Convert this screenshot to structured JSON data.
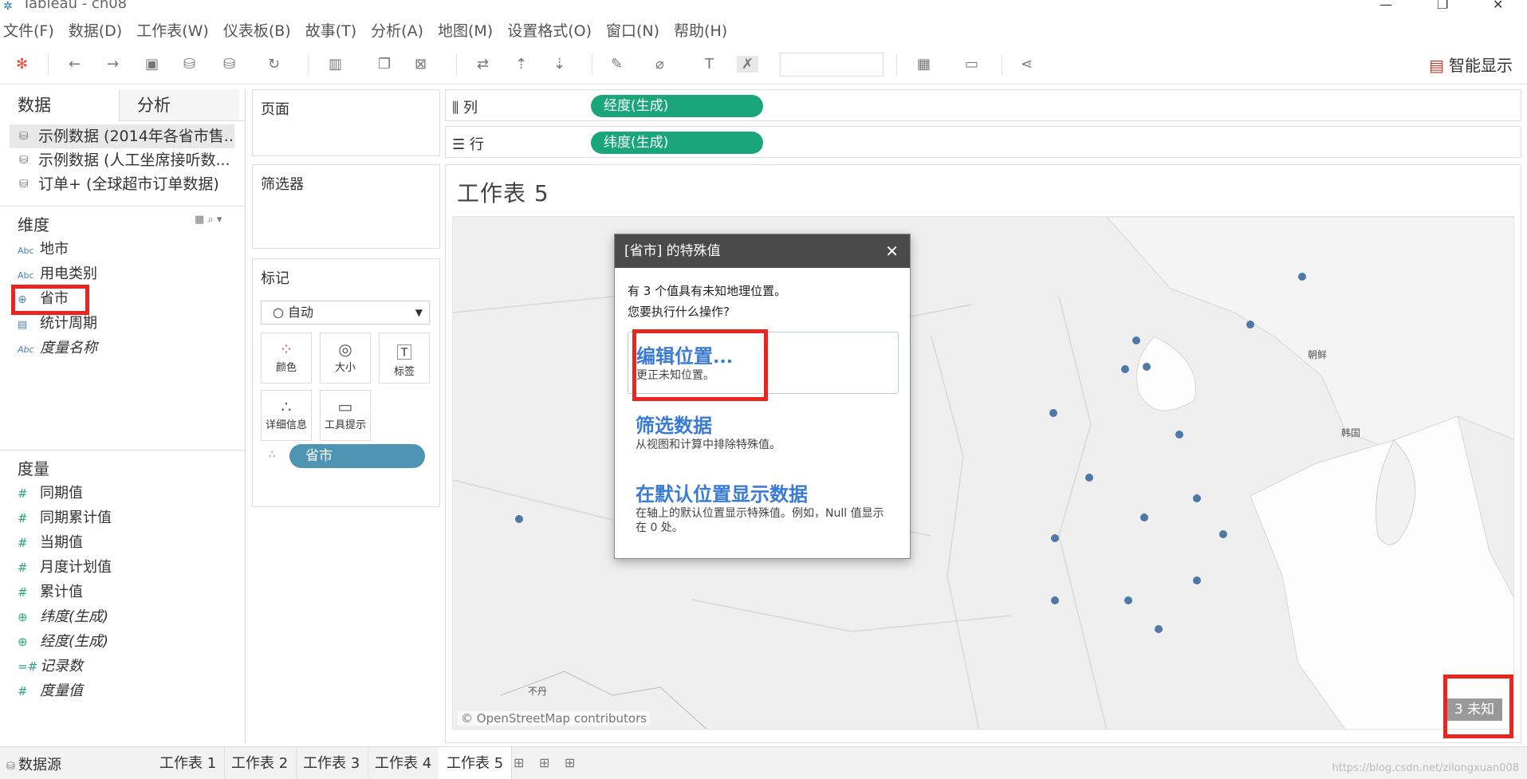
{
  "window": {
    "title": "Tableau - ch08"
  },
  "menu": [
    "文件(F)",
    "数据(D)",
    "工作表(W)",
    "仪表板(B)",
    "故事(T)",
    "分析(A)",
    "地图(M)",
    "设置格式(O)",
    "窗口(N)",
    "帮助(H)"
  ],
  "toolbar": {
    "smart_label": "智能显示"
  },
  "left": {
    "tab_data": "数据",
    "tab_analysis": "分析",
    "datasources": [
      "示例数据 (2014年各省市售...",
      "示例数据 (人工坐席接听数...",
      "订单+ (全球超市订单数据)"
    ],
    "dim_title": "维度",
    "dimensions": [
      {
        "icon": "Abc",
        "name": "地市"
      },
      {
        "icon": "Abc",
        "name": "用电类别"
      },
      {
        "icon": "⊕",
        "name": "省市"
      },
      {
        "icon": "▤",
        "name": "统计周期"
      },
      {
        "icon": "Abc",
        "name": "度量名称"
      }
    ],
    "mea_title": "度量",
    "measures": [
      {
        "icon": "#",
        "name": "同期值"
      },
      {
        "icon": "#",
        "name": "同期累计值"
      },
      {
        "icon": "#",
        "name": "当期值"
      },
      {
        "icon": "#",
        "name": "月度计划值"
      },
      {
        "icon": "#",
        "name": "累计值"
      },
      {
        "icon": "⊕",
        "name": "纬度(生成)"
      },
      {
        "icon": "⊕",
        "name": "经度(生成)"
      },
      {
        "icon": "=#",
        "name": "记录数"
      },
      {
        "icon": "#",
        "name": "度量值"
      }
    ]
  },
  "mid": {
    "pages": "页面",
    "filters": "筛选器",
    "marks": "标记",
    "mark_type": "自动",
    "buttons": [
      "颜色",
      "大小",
      "标签",
      "详细信息",
      "工具提示"
    ],
    "mark_pill": "省市"
  },
  "shelves": {
    "col_label": "列",
    "col_pill": "经度(生成)",
    "row_label": "行",
    "row_pill": "纬度(生成)"
  },
  "sheet": {
    "title": "工作表 5",
    "osm": "© OpenStreetMap contributors",
    "unknown": "3 未知",
    "labels": [
      "朝鲜",
      "韩国",
      "不丹"
    ]
  },
  "dialog": {
    "title": "[省市] 的特殊值",
    "msg1": "有 3 个值具有未知地理位置。",
    "msg2": "您要执行什么操作?",
    "opt1_title": "编辑位置...",
    "opt1_desc": "更正未知位置。",
    "opt2_title": "筛选数据",
    "opt2_desc": "从视图和计算中排除特殊值。",
    "opt3_title": "在默认位置显示数据",
    "opt3_desc": "在轴上的默认位置显示特殊值。例如，Null 值显示在 0 处。"
  },
  "bottom": {
    "datasource": "数据源",
    "sheets": [
      "工作表 1",
      "工作表 2",
      "工作表 3",
      "工作表 4",
      "工作表 5"
    ],
    "watermark": "https://blog.csdn.net/zilongxuan008"
  }
}
